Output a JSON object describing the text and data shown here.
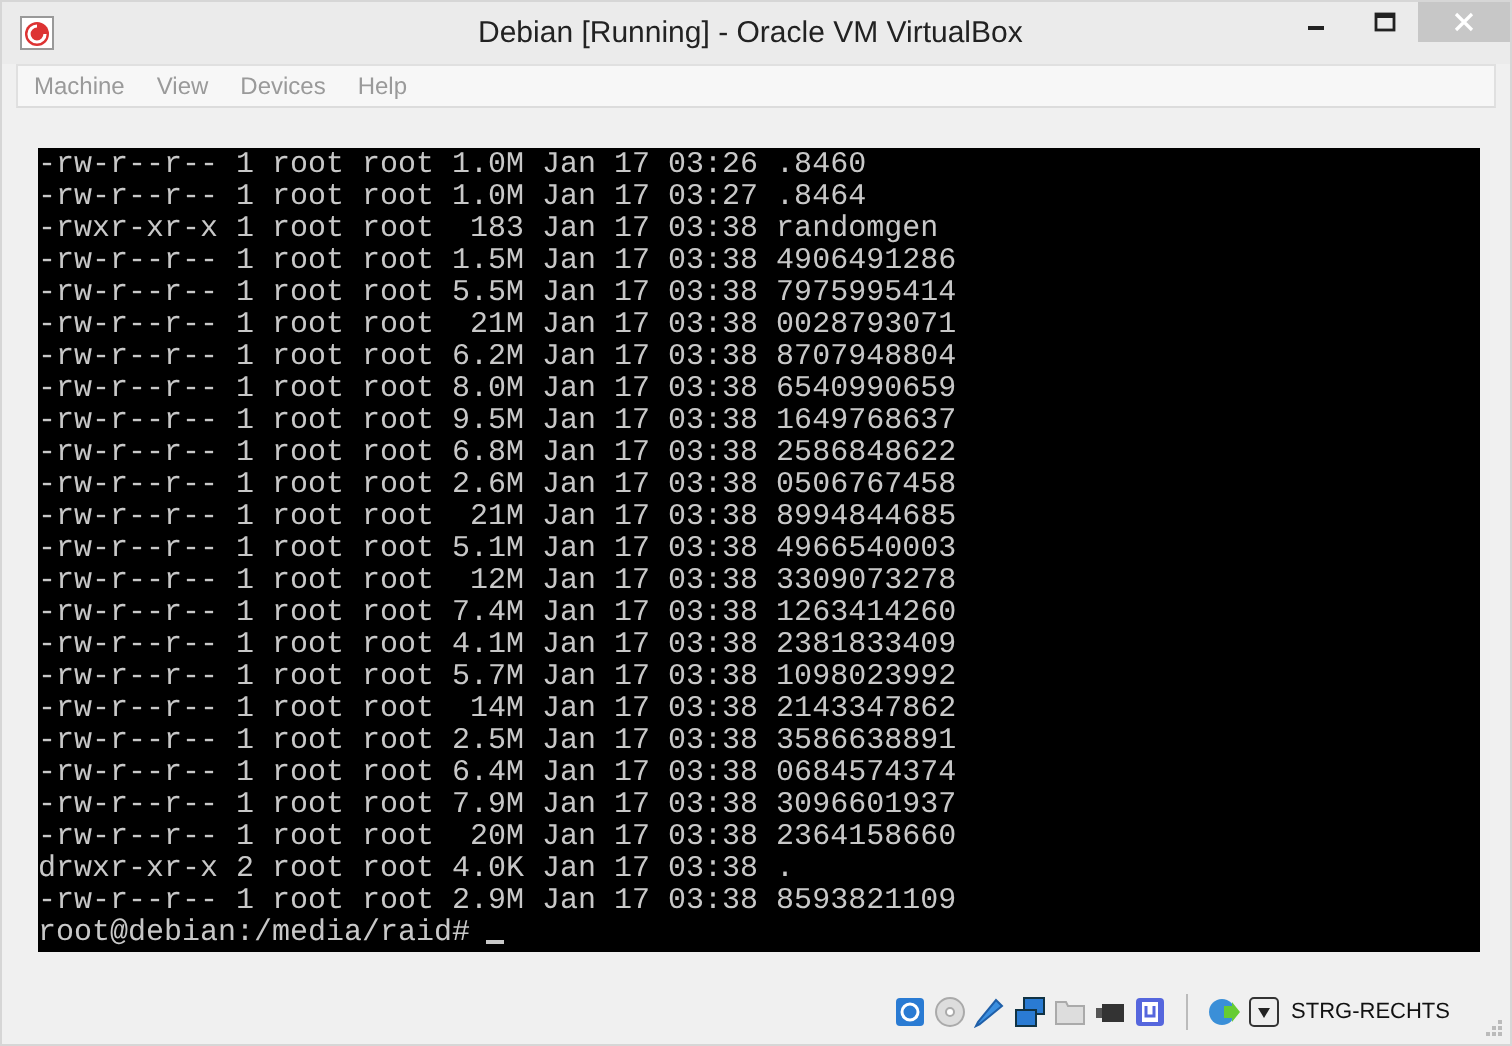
{
  "window": {
    "title": "Debian [Running] - Oracle VM VirtualBox"
  },
  "menu": [
    "Machine",
    "View",
    "Devices",
    "Help"
  ],
  "terminal": {
    "lines": [
      "-rw-r--r-- 1 root root 1.0M Jan 17 03:26 .8460",
      "-rw-r--r-- 1 root root 1.0M Jan 17 03:27 .8464",
      "-rwxr-xr-x 1 root root  183 Jan 17 03:38 randomgen",
      "-rw-r--r-- 1 root root 1.5M Jan 17 03:38 4906491286",
      "-rw-r--r-- 1 root root 5.5M Jan 17 03:38 7975995414",
      "-rw-r--r-- 1 root root  21M Jan 17 03:38 0028793071",
      "-rw-r--r-- 1 root root 6.2M Jan 17 03:38 8707948804",
      "-rw-r--r-- 1 root root 8.0M Jan 17 03:38 6540990659",
      "-rw-r--r-- 1 root root 9.5M Jan 17 03:38 1649768637",
      "-rw-r--r-- 1 root root 6.8M Jan 17 03:38 2586848622",
      "-rw-r--r-- 1 root root 2.6M Jan 17 03:38 0506767458",
      "-rw-r--r-- 1 root root  21M Jan 17 03:38 8994844685",
      "-rw-r--r-- 1 root root 5.1M Jan 17 03:38 4966540003",
      "-rw-r--r-- 1 root root  12M Jan 17 03:38 3309073278",
      "-rw-r--r-- 1 root root 7.4M Jan 17 03:38 1263414260",
      "-rw-r--r-- 1 root root 4.1M Jan 17 03:38 2381833409",
      "-rw-r--r-- 1 root root 5.7M Jan 17 03:38 1098023992",
      "-rw-r--r-- 1 root root  14M Jan 17 03:38 2143347862",
      "-rw-r--r-- 1 root root 2.5M Jan 17 03:38 3586638891",
      "-rw-r--r-- 1 root root 6.4M Jan 17 03:38 0684574374",
      "-rw-r--r-- 1 root root 7.9M Jan 17 03:38 3096601937",
      "-rw-r--r-- 1 root root  20M Jan 17 03:38 2364158660",
      "drwxr-xr-x 2 root root 4.0K Jan 17 03:38 .",
      "-rw-r--r-- 1 root root 2.9M Jan 17 03:38 8593821109"
    ],
    "prompt": "root@debian:/media/raid#"
  },
  "status_bar": {
    "host_key": "STRG-RECHTS"
  }
}
